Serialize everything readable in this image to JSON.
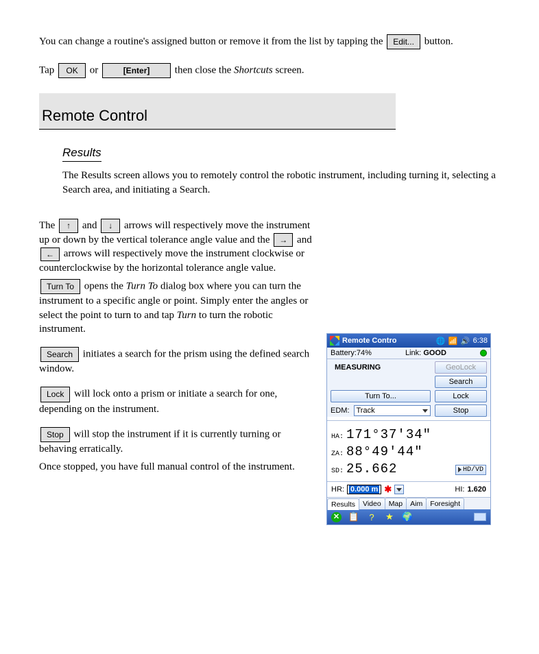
{
  "para1_a": "You can change a routine's assigned button or remove it from the list by tapping the",
  "para1_b": "button.",
  "para2_a": "Tap",
  "para2_b": "or",
  "para2_c": "then close the ",
  "para2_d": "Shortcuts",
  "para2_e": " screen.",
  "btn_edit": "Edit...",
  "btn_ok": "OK",
  "btn_enter": "[Enter]",
  "section_title": "Remote Control",
  "sub1": "Results",
  "sub1_body": "The Results screen allows you to remotely control the robotic instrument, including turning it, selecting a Search area, and initiating a Search.",
  "arrows_a": "The",
  "arrows_b": "and",
  "arrows_c": "arrows will respectively move the instrument up or down by the vertical tolerance angle value and the",
  "arrows_d": "arrows will respectively move the instrument clockwise or counterclockwise by the horizontal tolerance angle value.",
  "turnto_a": "opens the ",
  "turnto_b": "Turn To",
  "turnto_c": " dialog box where you can turn the instrument to a specific angle or point. Simply enter the angles or select the point to turn to and tap ",
  "turnto_d": "Turn",
  "turnto_e": " to turn the robotic instrument.",
  "btn_turnto": "Turn To",
  "btn_search": "Search",
  "search_text": " initiates a search for the prism using the defined search window.",
  "btn_lock": "Lock",
  "lock_text": " will lock onto a prism or initiate a search for one, depending on the instrument.",
  "btn_stop": "Stop",
  "stop_a": " will stop the instrument if it is currently turning or behaving erratically.",
  "stop_b": "Once stopped, you have full manual control of the instrument.",
  "up": "↑",
  "down": "↓",
  "right": "→",
  "left": "←",
  "device": {
    "title": "Remote Contro",
    "time": "6:38",
    "battery_label": "Battery:",
    "battery_val": "74%",
    "link_label": "Link:",
    "link_val": "GOOD",
    "state": "MEASURING",
    "geolock": "GeoLock",
    "search": "Search",
    "turnto": "Turn To...",
    "lock": "Lock",
    "edm_label": "EDM:",
    "edm_val": "Track",
    "stop": "Stop",
    "ha_lab": "HA:",
    "ha_val": "171°37'34\"",
    "za_lab": "ZA:",
    "za_val": "88°49'44\"",
    "sd_lab": "SD:",
    "sd_val": "25.662",
    "hdvd": "HD/VD",
    "hr_lab": "HR:",
    "hr_val": "0.000 m",
    "hi_lab": "HI:",
    "hi_val": "1.620",
    "tabs": {
      "results": "Results",
      "video": "Video",
      "map": "Map",
      "aim": "Aim",
      "foresight": "Foresight"
    }
  }
}
